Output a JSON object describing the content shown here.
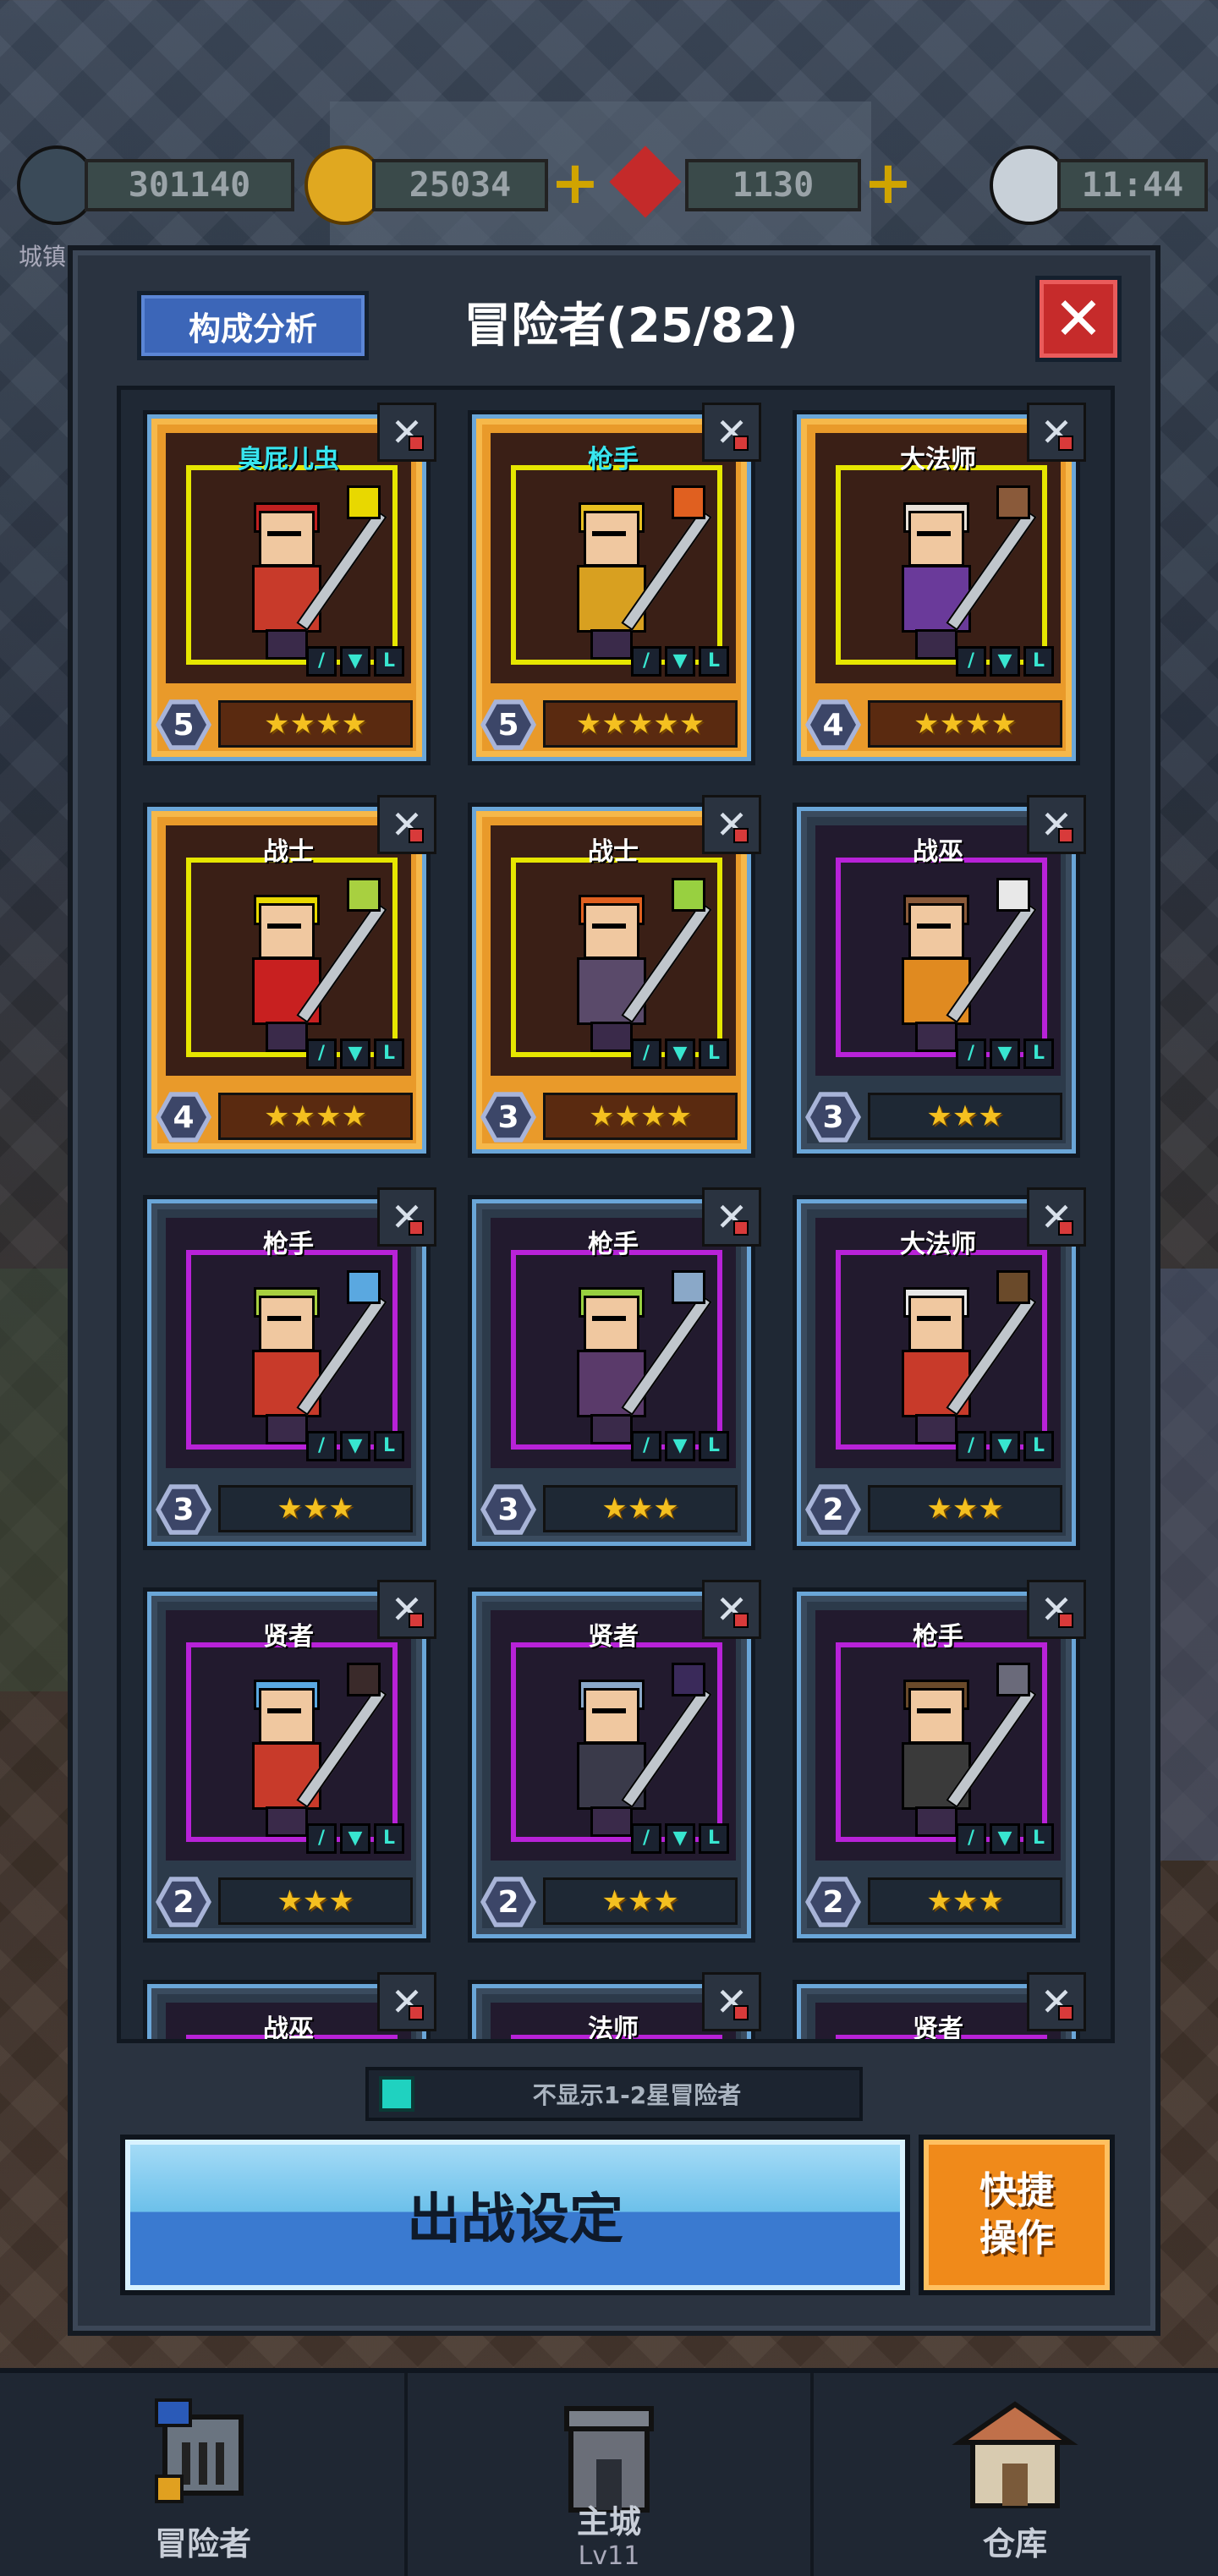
{
  "hud": {
    "power": "301140",
    "gold": "25034",
    "gems": "1130",
    "time": "11:44",
    "city_label": "城镇"
  },
  "dialog": {
    "analysis_button": "构成分析",
    "title": "冒险者(25/82)",
    "close_icon": "close-icon"
  },
  "cards": [
    {
      "title": "臭屁儿虫",
      "special": true,
      "frame": "gold",
      "level": "5",
      "stars": "★★★★"
    },
    {
      "title": "枪手",
      "special": true,
      "frame": "gold",
      "level": "5",
      "stars": "★★★★★"
    },
    {
      "title": "大法师",
      "special": false,
      "frame": "gold",
      "level": "4",
      "stars": "★★★★"
    },
    {
      "title": "战士",
      "special": false,
      "frame": "gold",
      "level": "4",
      "stars": "★★★★"
    },
    {
      "title": "战士",
      "special": false,
      "frame": "gold",
      "level": "3",
      "stars": "★★★★"
    },
    {
      "title": "战巫",
      "special": false,
      "frame": "blue",
      "level": "3",
      "stars": "★★★"
    },
    {
      "title": "枪手",
      "special": false,
      "frame": "blue",
      "level": "3",
      "stars": "★★★"
    },
    {
      "title": "枪手",
      "special": false,
      "frame": "blue",
      "level": "3",
      "stars": "★★★"
    },
    {
      "title": "大法师",
      "special": false,
      "frame": "blue",
      "level": "2",
      "stars": "★★★"
    },
    {
      "title": "贤者",
      "special": false,
      "frame": "blue",
      "level": "2",
      "stars": "★★★"
    },
    {
      "title": "贤者",
      "special": false,
      "frame": "blue",
      "level": "2",
      "stars": "★★★"
    },
    {
      "title": "枪手",
      "special": false,
      "frame": "blue",
      "level": "2",
      "stars": "★★★"
    },
    {
      "title": "战巫",
      "special": false,
      "frame": "blue",
      "level": "",
      "stars": ""
    },
    {
      "title": "法师",
      "special": false,
      "frame": "blue",
      "level": "",
      "stars": ""
    },
    {
      "title": "贤者",
      "special": false,
      "frame": "blue",
      "level": "",
      "stars": ""
    }
  ],
  "filter": {
    "label": "不显示1-2星冒险者",
    "checked": true
  },
  "buttons": {
    "deploy": "出战设定",
    "quick": "快捷\n操作"
  },
  "nav": {
    "adventurer": "冒险者",
    "main_city": "主城",
    "main_city_level": "Lv11",
    "warehouse": "仓库"
  },
  "colors": {
    "gold_frame": "#e99a2a",
    "blue_frame": "#2c3a4a",
    "deploy_button": "#6cc0ea",
    "quick_button": "#f08a1a",
    "close_button": "#c62b2b",
    "special_title": "#38e6f0"
  }
}
